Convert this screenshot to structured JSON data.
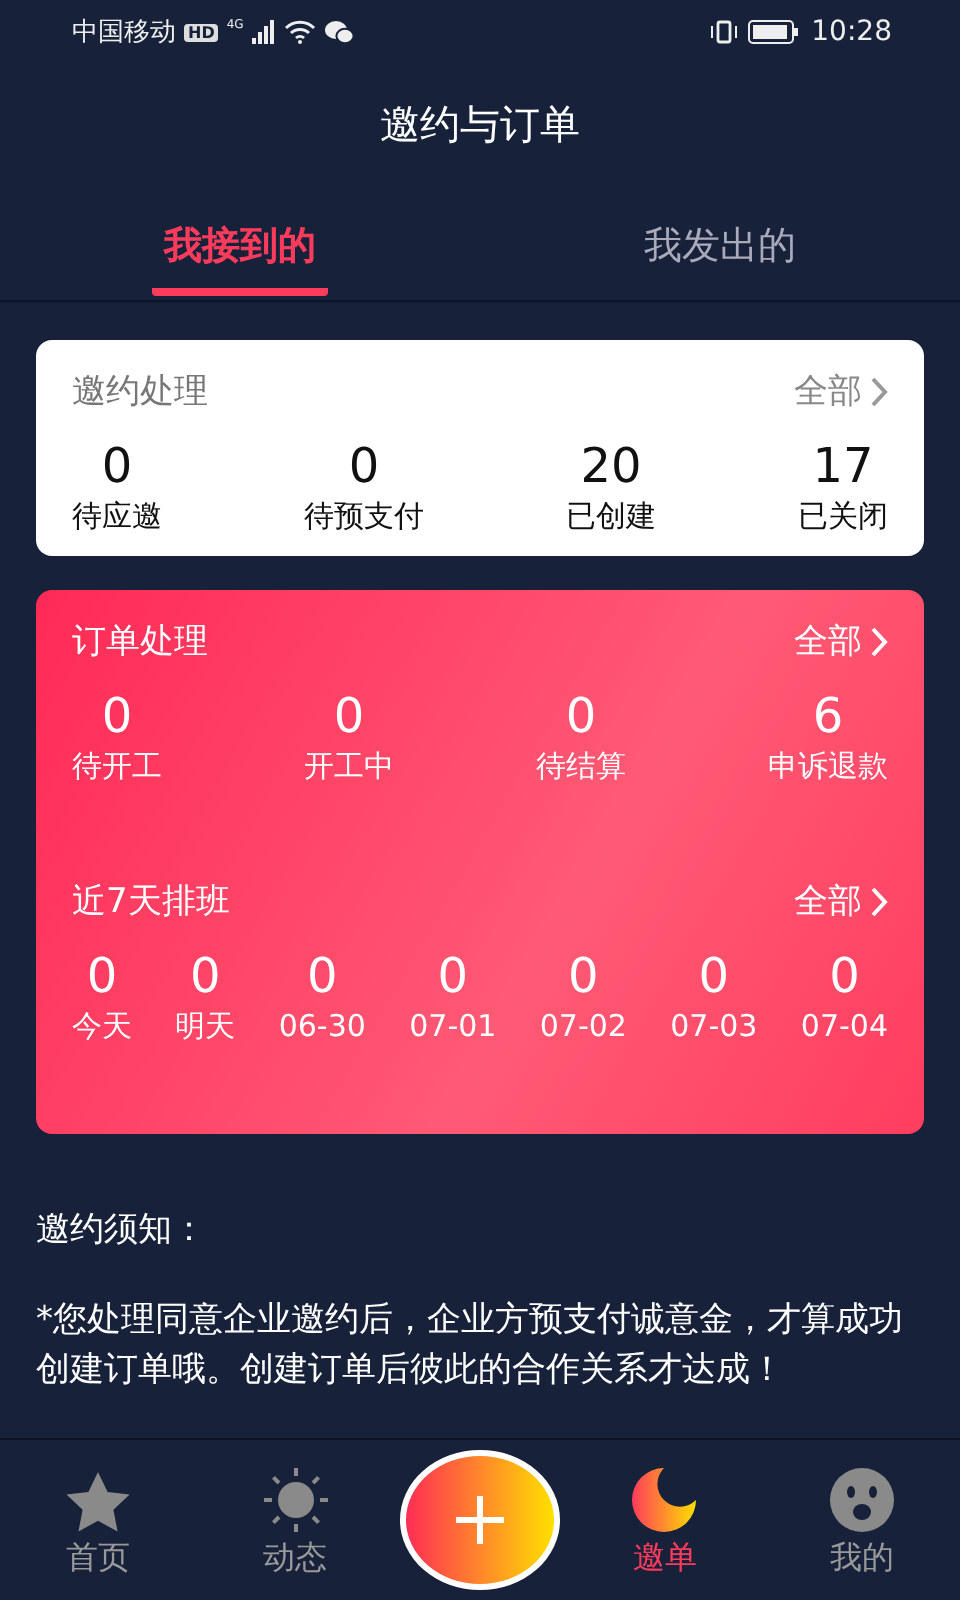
{
  "status_bar": {
    "carrier": "中国移动",
    "hd": "HD",
    "network": "4G",
    "time": "10:28"
  },
  "header": {
    "title": "邀约与订单"
  },
  "tabs": [
    {
      "label": "我接到的",
      "selected": true
    },
    {
      "label": "我发出的",
      "selected": false
    }
  ],
  "invite_card": {
    "title": "邀约处理",
    "more": "全部",
    "stats": [
      {
        "value": "0",
        "label": "待应邀"
      },
      {
        "value": "0",
        "label": "待预支付"
      },
      {
        "value": "20",
        "label": "已创建"
      },
      {
        "value": "17",
        "label": "已关闭"
      }
    ]
  },
  "order_card": {
    "sections": [
      {
        "title": "订单处理",
        "more": "全部",
        "stats": [
          {
            "value": "0",
            "label": "待开工"
          },
          {
            "value": "0",
            "label": "开工中"
          },
          {
            "value": "0",
            "label": "待结算"
          },
          {
            "value": "6",
            "label": "申诉退款"
          }
        ]
      },
      {
        "title": "近7天排班",
        "more": "全部",
        "stats": [
          {
            "value": "0",
            "label": "今天"
          },
          {
            "value": "0",
            "label": "明天"
          },
          {
            "value": "0",
            "label": "06-30"
          },
          {
            "value": "0",
            "label": "07-01"
          },
          {
            "value": "0",
            "label": "07-02"
          },
          {
            "value": "0",
            "label": "07-03"
          },
          {
            "value": "0",
            "label": "07-04"
          }
        ]
      }
    ]
  },
  "notice": {
    "title": "邀约须知：",
    "text": "*您处理同意企业邀约后，企业方预支付诚意金，才算成功创建订单哦。创建订单后彼此的合作关系才达成！"
  },
  "nav": [
    {
      "kind": "star",
      "label": "首页",
      "selected": false
    },
    {
      "kind": "sun",
      "label": "动态",
      "selected": false
    },
    {
      "kind": "plus",
      "selected": false
    },
    {
      "kind": "moon",
      "label": "邀单",
      "selected": true
    },
    {
      "kind": "face",
      "label": "我的",
      "selected": false
    }
  ]
}
